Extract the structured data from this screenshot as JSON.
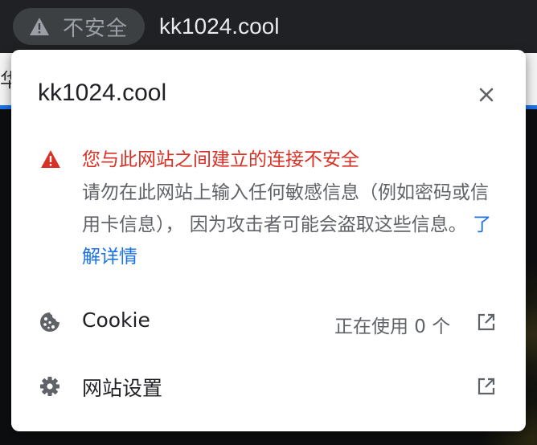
{
  "address_bar": {
    "security_chip_label": "不安全",
    "url": "kk1024.cool"
  },
  "background_page": {
    "left_glyph": "华"
  },
  "popup": {
    "title": "kk1024.cool",
    "warning": {
      "title": "您与此网站之间建立的连接不安全",
      "body": "请勿在此网站上输入任何敏感信息（例如密码或信用卡信息）， 因为攻击者可能会盗取这些信息。 ",
      "learn_more": "了解详情"
    },
    "cookie_row": {
      "label": "Cookie",
      "status": "正在使用 0 个"
    },
    "settings_row": {
      "label": "网站设置"
    }
  },
  "colors": {
    "warning_red": "#d93025",
    "link_blue": "#1a73e8",
    "icon_gray": "#5f6368",
    "toolbar_dark": "#202124"
  }
}
